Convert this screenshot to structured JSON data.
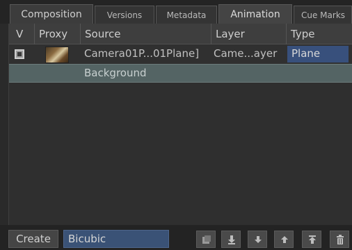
{
  "tabs": [
    {
      "label": "Composition"
    },
    {
      "label": "Versions"
    },
    {
      "label": "Metadata"
    },
    {
      "label": "Animation"
    },
    {
      "label": "Cue Marks"
    }
  ],
  "table": {
    "headers": {
      "v": "V",
      "proxy": "Proxy",
      "source": "Source",
      "layer": "Layer",
      "type": "Type"
    },
    "rows": [
      {
        "source": "Camera01P...01Plane]",
        "layer": "Came...ayer",
        "type": "Plane"
      },
      {
        "source": "Background"
      }
    ]
  },
  "toolbar": {
    "create_label": "Create",
    "interpolation_value": "Bicubic",
    "icons": [
      "clip-icon",
      "import-icon",
      "move-down-icon",
      "move-up-icon",
      "move-to-top-icon",
      "trash-icon"
    ]
  },
  "colors": {
    "selection_blue": "#38507c",
    "highlight_row": "#546464"
  }
}
